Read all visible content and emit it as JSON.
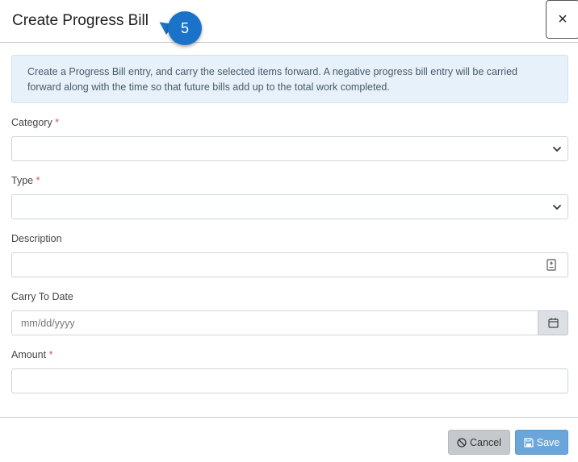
{
  "modal": {
    "title": "Create Progress Bill",
    "step_number": "5",
    "close_label": "×",
    "info_text": "Create a Progress Bill entry, and carry the selected items forward. A negative progress bill entry will be carried forward along with the time so that future bills add up to the total work completed."
  },
  "form": {
    "category": {
      "label": "Category",
      "required_mark": "*",
      "value": ""
    },
    "type": {
      "label": "Type",
      "required_mark": "*",
      "value": ""
    },
    "description": {
      "label": "Description",
      "value": ""
    },
    "carry_to_date": {
      "label": "Carry To Date",
      "placeholder": "mm/dd/yyyy",
      "value": ""
    },
    "amount": {
      "label": "Amount",
      "required_mark": "*",
      "value": ""
    }
  },
  "footer": {
    "cancel_label": "Cancel",
    "save_label": "Save"
  },
  "icons": {
    "close": "close-icon",
    "category_dropdown": "chevron-down-icon",
    "type_dropdown": "chevron-down-icon",
    "description": "text-expand-icon",
    "date_picker": "calendar-icon",
    "cancel": "ban-icon",
    "save": "floppy-disk-icon"
  },
  "colors": {
    "step_badge": "#1a73c8",
    "info_background": "#e6f1fa",
    "required": "#d9534f",
    "save_button": "#6aa6d9",
    "cancel_button": "#c5c9cd"
  }
}
